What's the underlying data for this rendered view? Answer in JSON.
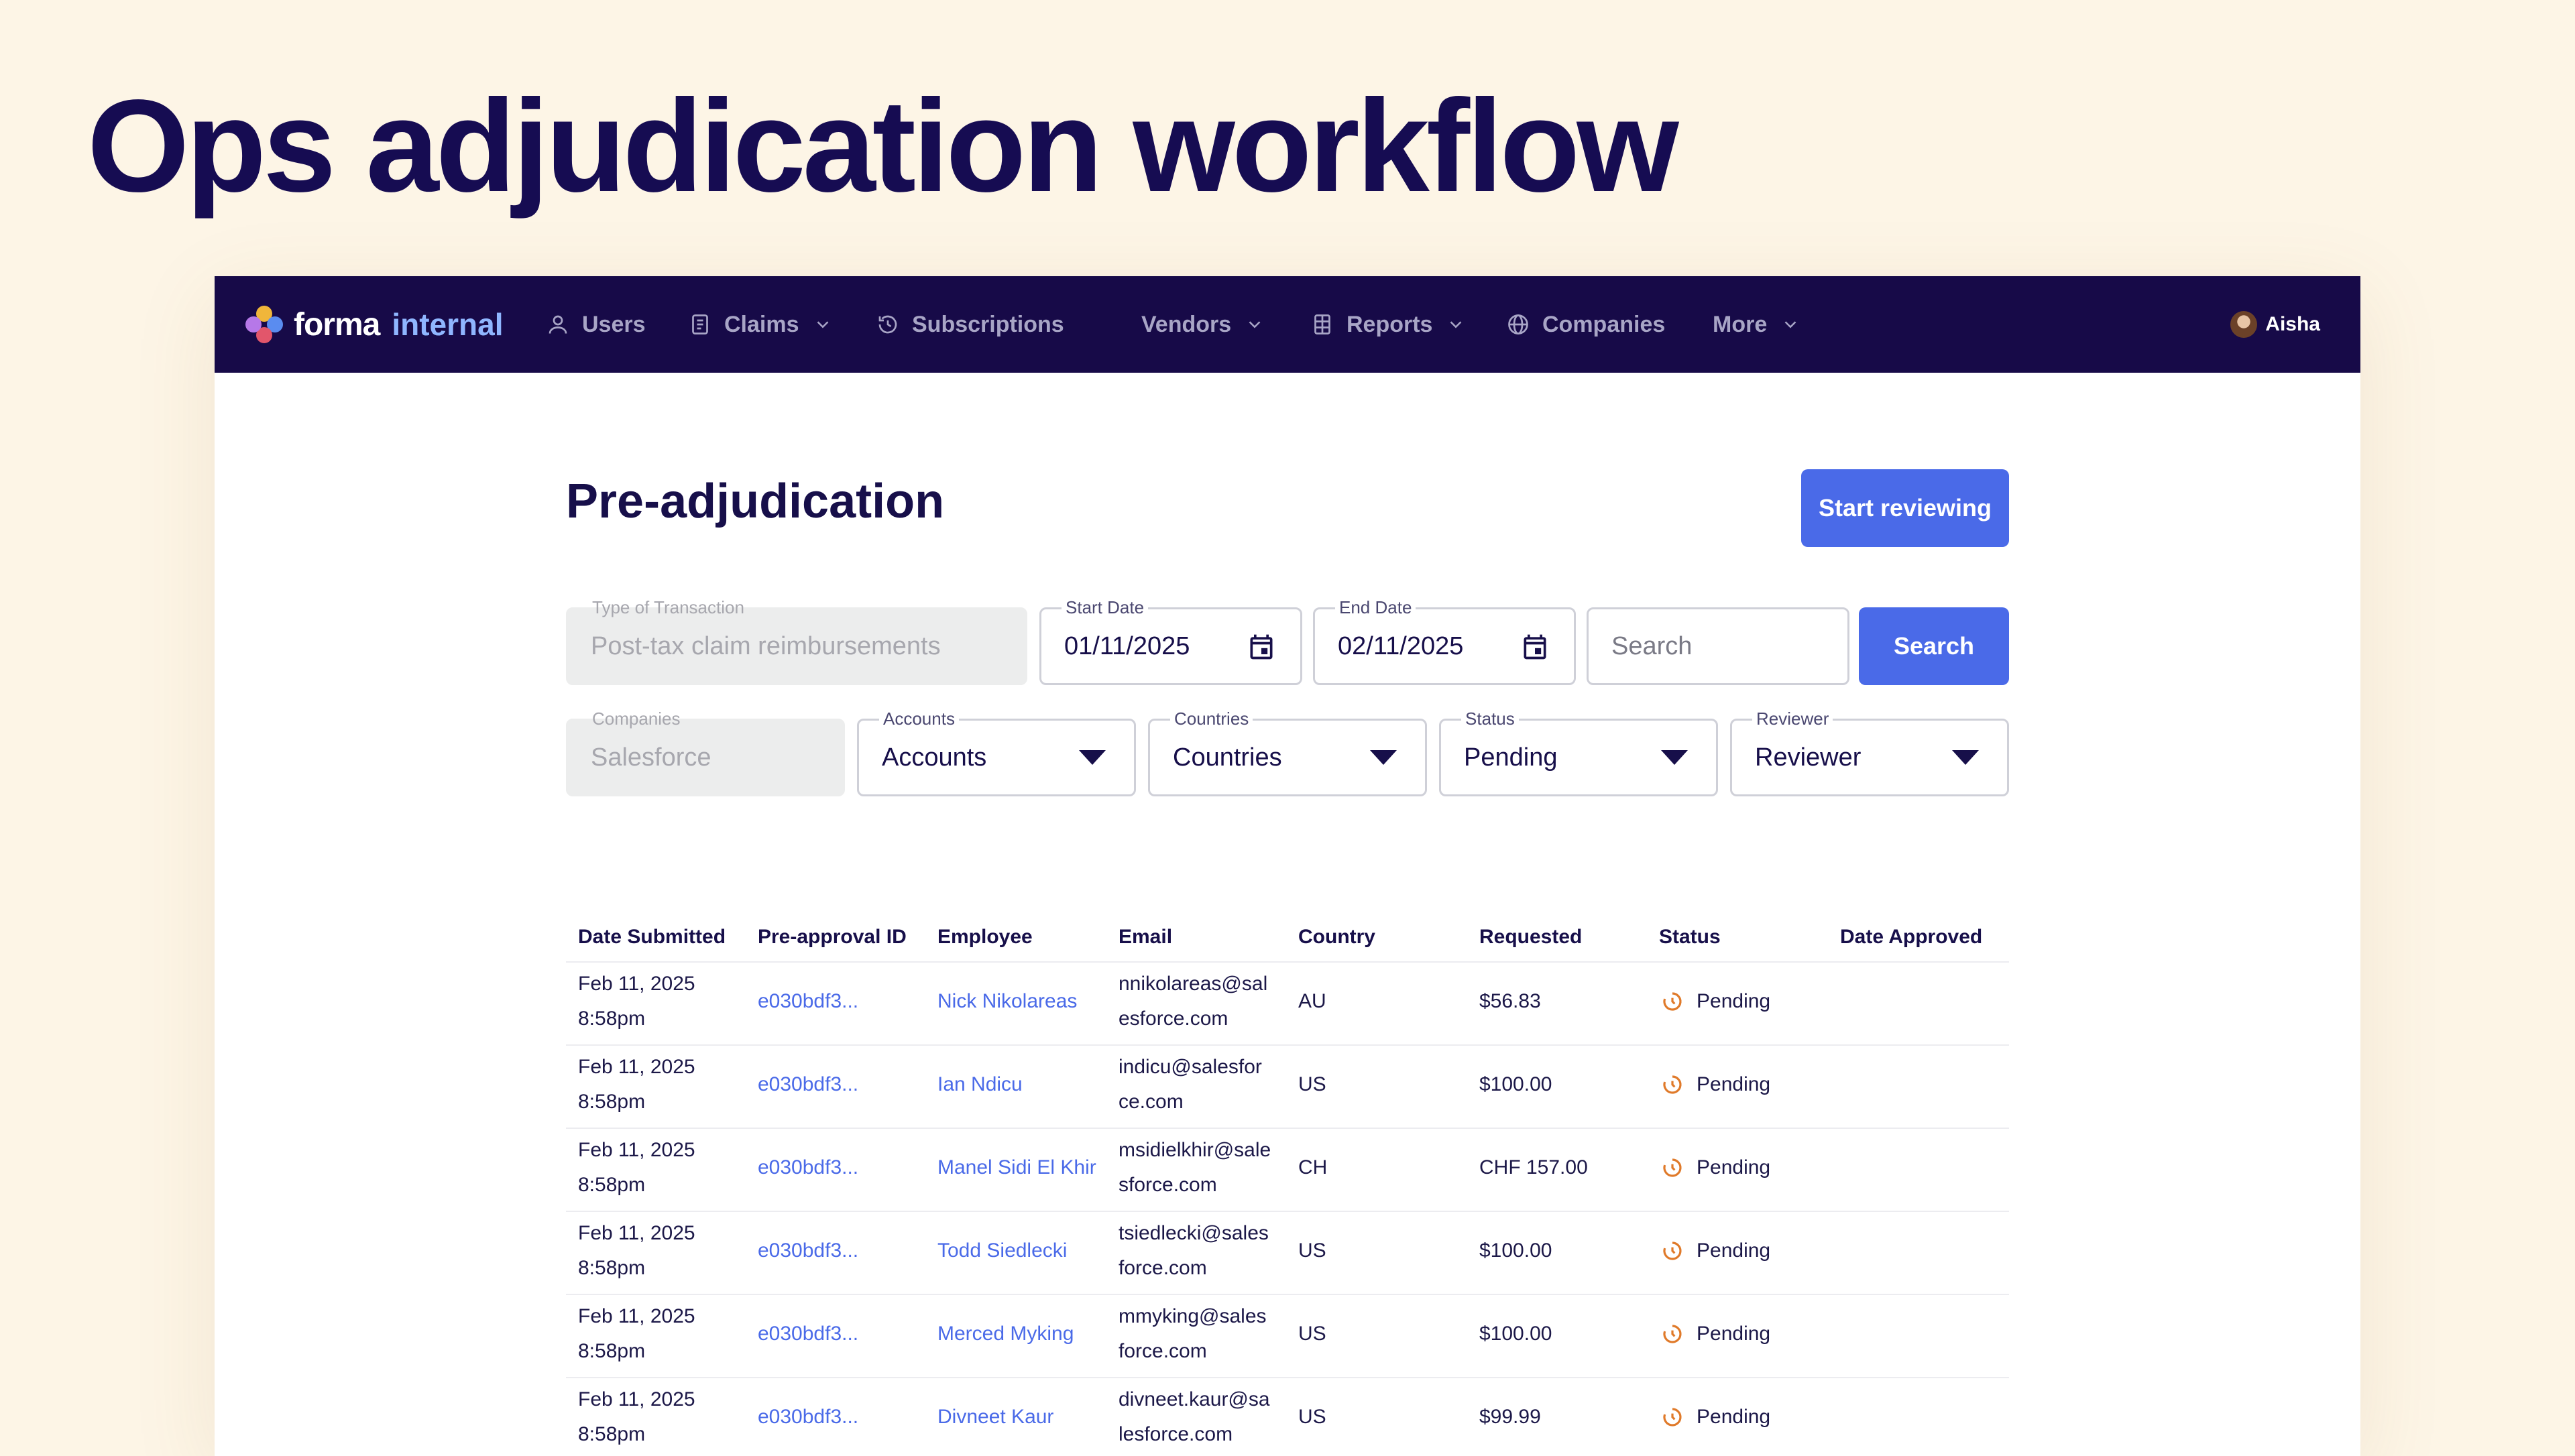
{
  "slide_title": "Ops adjudication workflow",
  "nav": {
    "logo_word": "forma",
    "logo_tag": "internal",
    "items": [
      {
        "label": "Users",
        "icon": "user-icon"
      },
      {
        "label": "Claims",
        "icon": "document-icon"
      },
      {
        "label": "Subscriptions",
        "icon": "history-icon"
      },
      {
        "label": "Vendors"
      },
      {
        "label": "Reports",
        "icon": "table-icon"
      },
      {
        "label": "Companies",
        "icon": "globe-icon"
      },
      {
        "label": "More"
      }
    ],
    "user_name": "Aisha"
  },
  "page": {
    "title": "Pre-adjudication",
    "start_button": "Start reviewing"
  },
  "filters": {
    "transaction_type": {
      "label": "Type of Transaction",
      "value": "Post-tax claim reimbursements"
    },
    "start_date": {
      "label": "Start Date",
      "value": "01/11/2025"
    },
    "end_date": {
      "label": "End Date",
      "value": "02/11/2025"
    },
    "search": {
      "placeholder": "Search"
    },
    "search_button": "Search",
    "companies": {
      "label": "Companies",
      "value": "Salesforce"
    },
    "accounts": {
      "label": "Accounts",
      "value": "Accounts"
    },
    "countries": {
      "label": "Countries",
      "value": "Countries"
    },
    "status": {
      "label": "Status",
      "value": "Pending"
    },
    "reviewer": {
      "label": "Reviewer",
      "value": "Reviewer"
    }
  },
  "table": {
    "columns": [
      "Date Submitted",
      "Pre-approval ID",
      "Employee",
      "Email",
      "Country",
      "Requested",
      "Status",
      "Date Approved"
    ],
    "rows": [
      {
        "date": "Feb 11, 2025",
        "time": "8:58pm",
        "id": "e030bdf3...",
        "employee": "Nick Nikolareas",
        "email1": "nnikolareas@sal",
        "email2": "esforce.com",
        "country": "AU",
        "requested": "$56.83",
        "status": "Pending",
        "approved": ""
      },
      {
        "date": "Feb 11, 2025",
        "time": "8:58pm",
        "id": "e030bdf3...",
        "employee": "Ian Ndicu",
        "email1": "indicu@salesfor",
        "email2": "ce.com",
        "country": "US",
        "requested": "$100.00",
        "status": "Pending",
        "approved": ""
      },
      {
        "date": "Feb 11, 2025",
        "time": "8:58pm",
        "id": "e030bdf3...",
        "employee": "Manel Sidi El Khir",
        "email1": "msidielkhir@sale",
        "email2": "sforce.com",
        "country": "CH",
        "requested": "CHF 157.00",
        "status": "Pending",
        "approved": ""
      },
      {
        "date": "Feb 11, 2025",
        "time": "8:58pm",
        "id": "e030bdf3...",
        "employee": "Todd Siedlecki",
        "email1": "tsiedlecki@sales",
        "email2": "force.com",
        "country": "US",
        "requested": "$100.00",
        "status": "Pending",
        "approved": ""
      },
      {
        "date": "Feb 11, 2025",
        "time": "8:58pm",
        "id": "e030bdf3...",
        "employee": "Merced Myking",
        "email1": "mmyking@sales",
        "email2": "force.com",
        "country": "US",
        "requested": "$100.00",
        "status": "Pending",
        "approved": ""
      },
      {
        "date": "Feb 11, 2025",
        "time": "8:58pm",
        "id": "e030bdf3...",
        "employee": "Divneet Kaur",
        "email1": "divneet.kaur@sa",
        "email2": "lesforce.com",
        "country": "US",
        "requested": "$99.99",
        "status": "Pending",
        "approved": ""
      }
    ]
  },
  "colors": {
    "accent": "#4a6ae8",
    "nav_bg": "#170a48",
    "pending": "#e07a2a"
  }
}
